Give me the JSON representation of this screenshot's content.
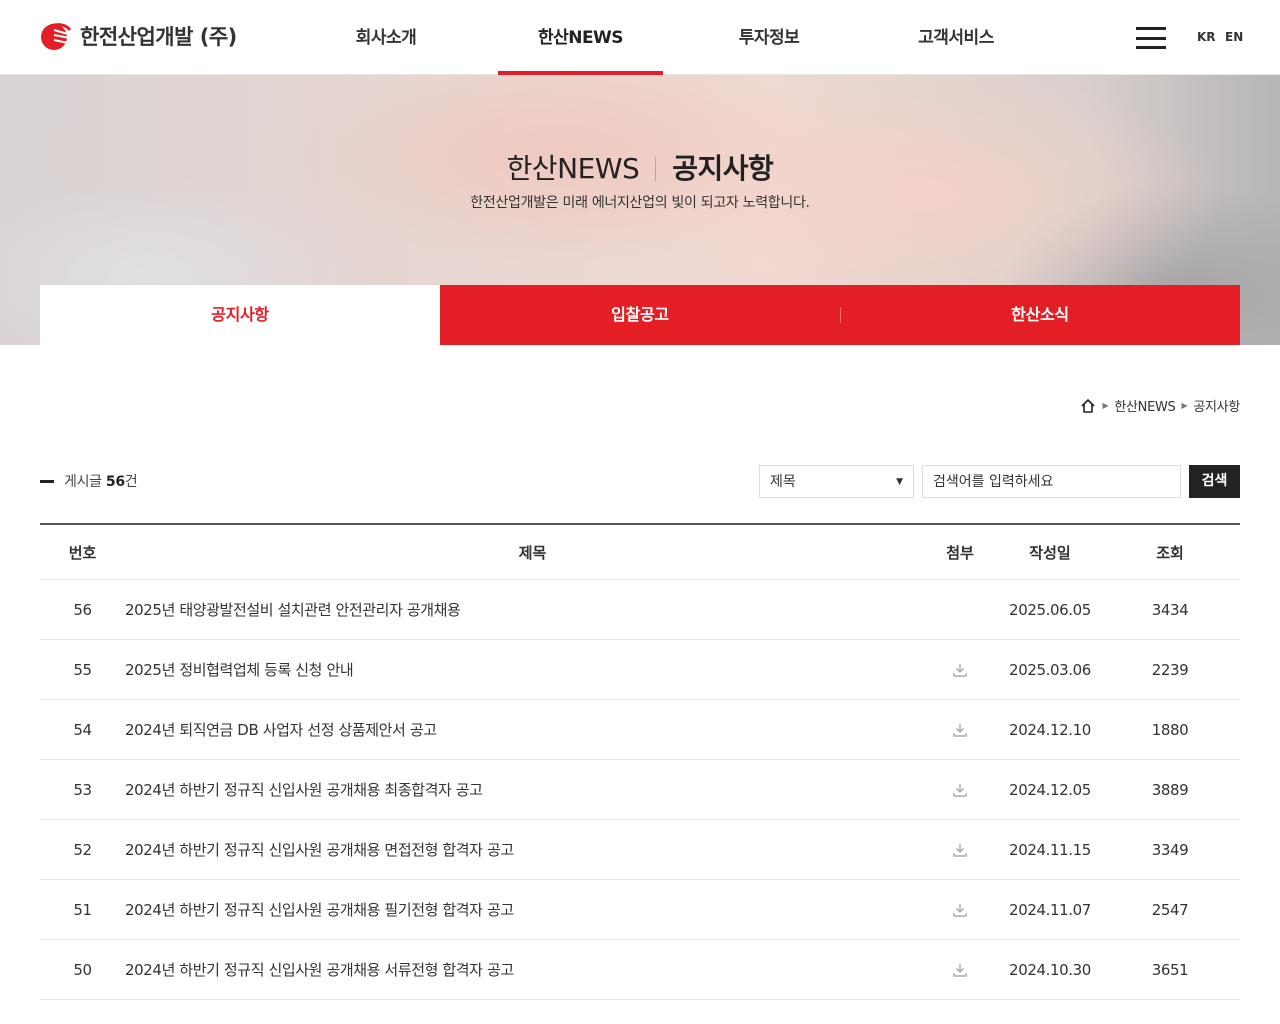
{
  "header": {
    "logo_text": "한전산업개발 (주)",
    "nav": [
      "회사소개",
      "한산NEWS",
      "투자정보",
      "고객서비스"
    ],
    "active_nav": "한산NEWS",
    "lang": [
      "KR",
      "EN"
    ]
  },
  "hero": {
    "title_light": "한산NEWS",
    "title_strong": "공지사항",
    "subtitle": "한전산업개발은 미래 에너지산업의 빛이 되고자 노력합니다."
  },
  "subtabs": [
    "공지사항",
    "입찰공고",
    "한산소식"
  ],
  "breadcrumb": [
    "한산NEWS",
    "공지사항"
  ],
  "board": {
    "total_prefix": "게시글",
    "total_count": "56",
    "total_suffix": "건",
    "search": {
      "select_value": "제목",
      "placeholder": "검색어를 입력하세요",
      "button": "검색"
    },
    "columns": [
      "번호",
      "제목",
      "첨부",
      "작성일",
      "조회"
    ],
    "rows": [
      {
        "num": "56",
        "title": "2025년 태양광발전설비 설치관련 안전관리자 공개채용",
        "attach": false,
        "date": "2025.06.05",
        "views": "3434"
      },
      {
        "num": "55",
        "title": "2025년 정비협력업체 등록 신청 안내",
        "attach": true,
        "date": "2025.03.06",
        "views": "2239"
      },
      {
        "num": "54",
        "title": "2024년 퇴직연금 DB 사업자 선정 상품제안서 공고",
        "attach": true,
        "date": "2024.12.10",
        "views": "1880"
      },
      {
        "num": "53",
        "title": "2024년 하반기 정규직 신입사원 공개채용 최종합격자 공고",
        "attach": true,
        "date": "2024.12.05",
        "views": "3889"
      },
      {
        "num": "52",
        "title": "2024년 하반기 정규직 신입사원 공개채용 면접전형 합격자 공고",
        "attach": true,
        "date": "2024.11.15",
        "views": "3349"
      },
      {
        "num": "51",
        "title": "2024년 하반기 정규직 신입사원 공개채용 필기전형 합격자 공고",
        "attach": true,
        "date": "2024.11.07",
        "views": "2547"
      },
      {
        "num": "50",
        "title": "2024년 하반기 정규직 신입사원 공개채용 서류전형 합격자 공고",
        "attach": true,
        "date": "2024.10.30",
        "views": "3651"
      }
    ]
  },
  "colors": {
    "accent": "#e31e24",
    "dark": "#222222"
  }
}
